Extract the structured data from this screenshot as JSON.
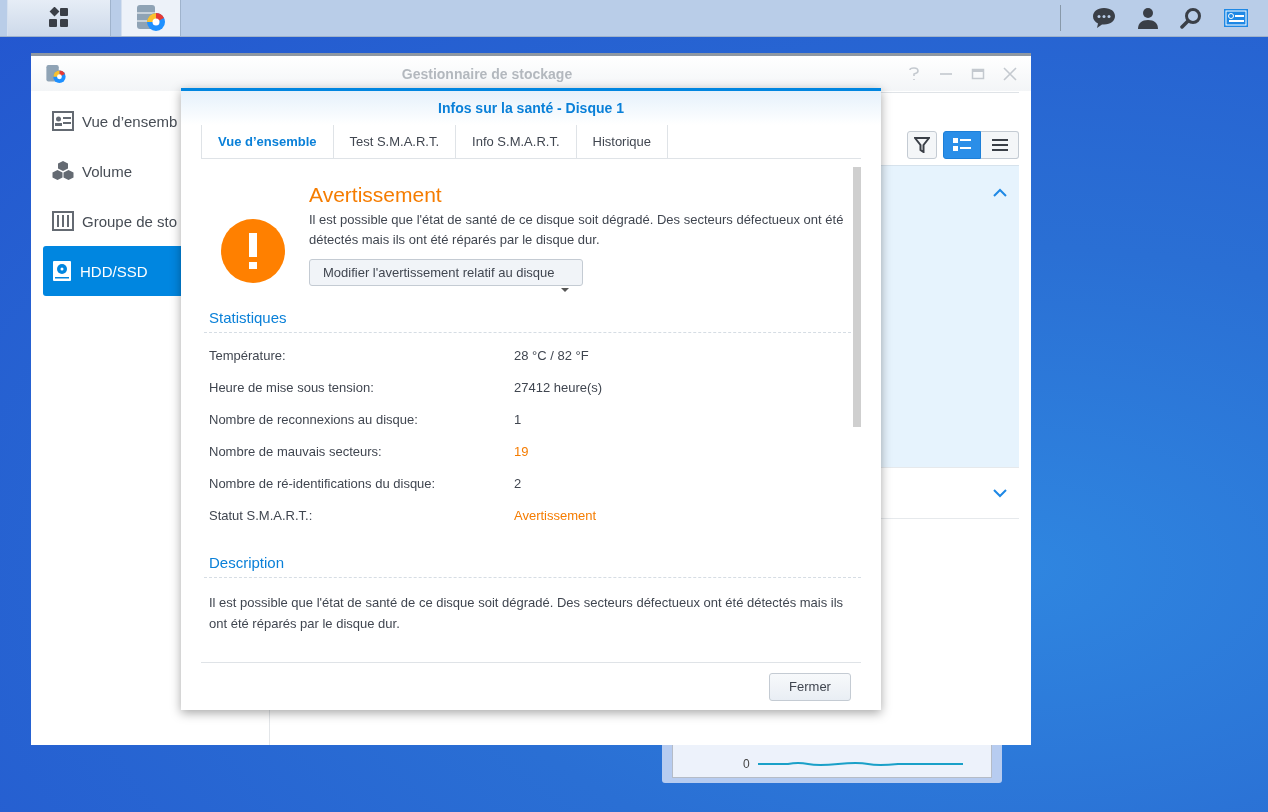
{
  "taskbar": {
    "apps": [
      {
        "kind": "menu"
      },
      {
        "kind": "storage"
      }
    ],
    "tray": [
      {
        "kind": "chat"
      },
      {
        "kind": "user"
      },
      {
        "kind": "search"
      },
      {
        "kind": "widgets"
      }
    ]
  },
  "window": {
    "title": "Gestionnaire de stockage",
    "sidebar": {
      "items": [
        {
          "label": "Vue d’ensemb",
          "kind": "overview",
          "selected": false
        },
        {
          "label": "Volume",
          "kind": "volume",
          "selected": false
        },
        {
          "label": "Groupe de sto",
          "kind": "group",
          "selected": false
        },
        {
          "label": "HDD/SSD",
          "kind": "disk",
          "selected": true
        }
      ]
    },
    "view_modes": [
      {
        "kind": "detail",
        "selected": true
      },
      {
        "kind": "list",
        "selected": false
      }
    ],
    "panels": [
      {
        "expanded": true
      },
      {
        "expanded": false
      }
    ]
  },
  "widget": {
    "axis_label": "0"
  },
  "dialog": {
    "title": "Infos sur la santé - Disque 1",
    "tabs": [
      {
        "label": "Vue d’ensemble",
        "selected": true
      },
      {
        "label": "Test S.M.A.R.T.",
        "selected": false
      },
      {
        "label": "Info S.M.A.R.T.",
        "selected": false
      },
      {
        "label": "Historique",
        "selected": false
      }
    ],
    "status": {
      "title": "Avertissement",
      "message": "Il est possible que l'état de santé de ce disque soit dégradé. Des secteurs défectueux ont été détectés mais ils ont été réparés par le disque dur.",
      "button": "Modifier l'avertissement relatif au disque"
    },
    "statistics": {
      "title": "Statistiques",
      "rows": [
        {
          "label": "Température:",
          "value": "28 °C / 82 °F",
          "warning": false
        },
        {
          "label": "Heure de mise sous tension:",
          "value": "27412 heure(s)",
          "warning": false
        },
        {
          "label": "Nombre de reconnexions au disque:",
          "value": "1",
          "warning": false
        },
        {
          "label": "Nombre de mauvais secteurs:",
          "value": "19",
          "warning": true
        },
        {
          "label": "Nombre de ré-identifications du disque:",
          "value": "2",
          "warning": false
        },
        {
          "label": "Statut S.M.A.R.T.:",
          "value": "Avertissement",
          "warning": true
        }
      ]
    },
    "description": {
      "title": "Description",
      "text": "Il est possible que l'état de santé de ce disque soit dégradé. Des secteurs défectueux ont été détectés mais ils ont été réparés par le disque dur."
    },
    "close_button": "Fermer"
  }
}
